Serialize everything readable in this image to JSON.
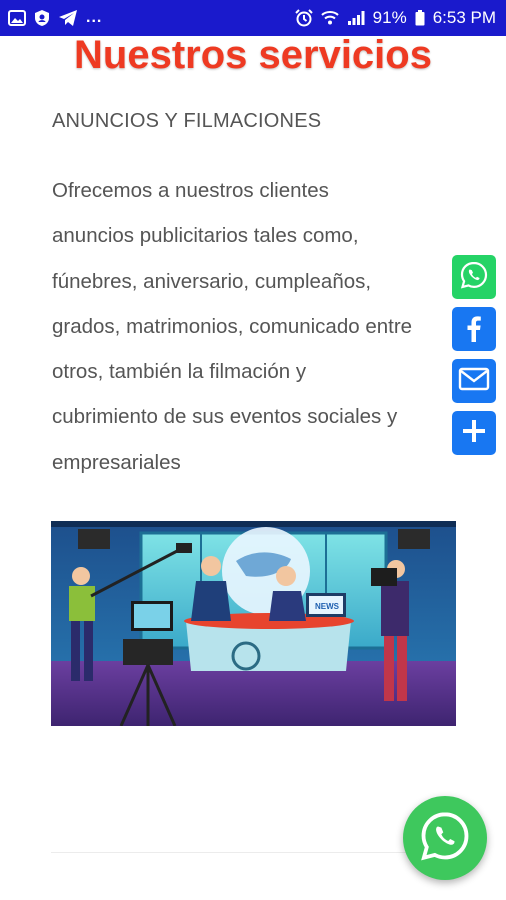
{
  "status_bar": {
    "battery": "91%",
    "time": "6:53 PM",
    "more": "..."
  },
  "page": {
    "title": "Nuestros servicios",
    "section_heading": "ANUNCIOS Y FILMACIONES",
    "body_lines": [
      "Ofrecemos a nuestros clientes",
      "anuncios publicitarios tales como,",
      "fúnebres, aniversario, cumpleaños,",
      "grados, matrimonios, comunicado entre",
      "otros, también la filmación y",
      "cubrimiento de sus eventos sociales y",
      "empresariales"
    ],
    "illustration_sign": "NEWS"
  },
  "share_buttons": [
    {
      "icon": "whatsapp-icon",
      "color": "#25d366"
    },
    {
      "icon": "facebook-icon",
      "color": "#1877f2"
    },
    {
      "icon": "email-icon",
      "color": "#1877f2"
    },
    {
      "icon": "plus-icon",
      "color": "#1877f2"
    }
  ],
  "colors": {
    "status_bar": "#1a1acc",
    "title": "#ee3a22",
    "text": "#555555",
    "fab": "#3ec85d"
  }
}
